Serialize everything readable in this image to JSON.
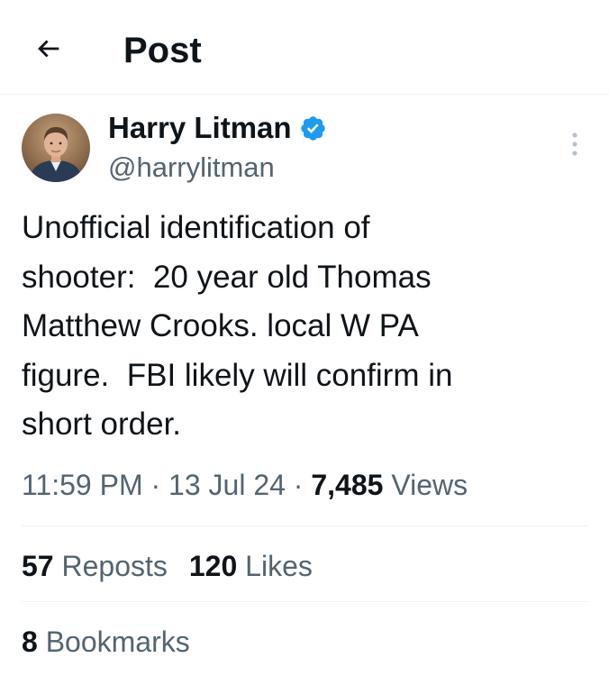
{
  "header": {
    "title": "Post",
    "back_icon": "arrow-left-icon"
  },
  "author": {
    "display_name": "Harry Litman",
    "handle": "@harrylitman",
    "verified": true,
    "verified_color": "#1d9bf0",
    "avatar_icon": "avatar-photo"
  },
  "tweet": {
    "text": "Unofficial identification of\nshooter:  20 year old Thomas\nMatthew Crooks. local W PA\nfigure.  FBI likely will confirm in\nshort order."
  },
  "meta": {
    "time": "11:59 PM",
    "separator": "·",
    "date": "13 Jul 24",
    "views_count": "7,485",
    "views_label": "Views"
  },
  "stats": {
    "reposts_count": "57",
    "reposts_label": "Reposts",
    "likes_count": "120",
    "likes_label": "Likes",
    "bookmarks_count": "8",
    "bookmarks_label": "Bookmarks"
  },
  "more_icon": "more-vertical-icon"
}
